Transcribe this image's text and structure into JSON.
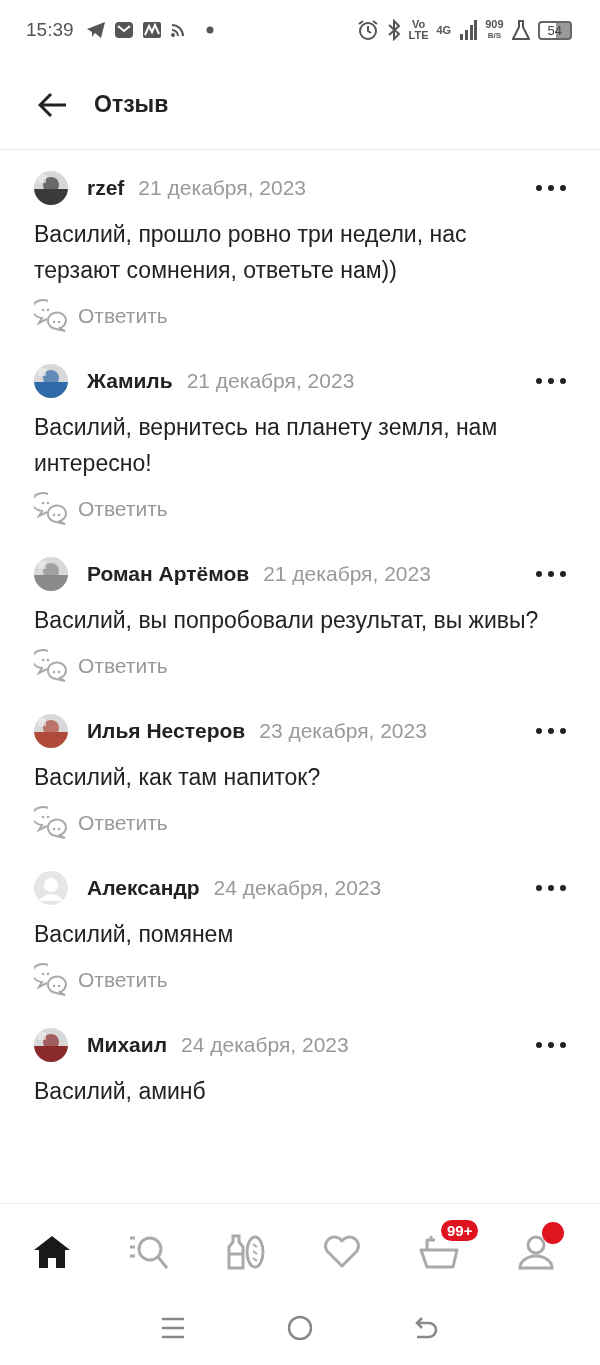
{
  "status_bar": {
    "time": "15:39",
    "volte_top": "Vo",
    "volte_bottom": "LTE",
    "network": "4G",
    "speed_value": "909",
    "speed_unit": "B/S",
    "battery": "54"
  },
  "header": {
    "title": "Отзыв"
  },
  "comments": [
    {
      "author": "rzef",
      "date": "21 декабря, 2023",
      "text": "Василий, прошло ровно три недели, нас терзают сомнения, ответьте нам))",
      "reply": "Ответить"
    },
    {
      "author": "Жамиль",
      "date": "21 декабря, 2023",
      "text": "Василий, вернитесь на планету земля, нам интересно!",
      "reply": "Ответить"
    },
    {
      "author": "Роман Артёмов",
      "date": "21 декабря, 2023",
      "text": "Василий, вы попробовали результат, вы живы?",
      "reply": "Ответить"
    },
    {
      "author": "Илья Нестеров",
      "date": "23 декабря, 2023",
      "text": "Василий, как там напиток?",
      "reply": "Ответить"
    },
    {
      "author": "Александр",
      "date": "24 декабря, 2023",
      "text": "Василий, помянем",
      "reply": "Ответить",
      "avatar": {
        "kind": "placeholder"
      }
    },
    {
      "author": "Михаил",
      "date": "24 декабря, 2023",
      "text": "Василий, аминб"
    }
  ],
  "bottom_nav": [
    {
      "kind": "home",
      "selected": true
    },
    {
      "kind": "search",
      "selected": false
    },
    {
      "kind": "catalog",
      "selected": false
    },
    {
      "kind": "favorites",
      "selected": false
    },
    {
      "kind": "cart",
      "selected": false,
      "badge": "99+"
    },
    {
      "kind": "profile",
      "selected": false,
      "dot": true
    }
  ]
}
